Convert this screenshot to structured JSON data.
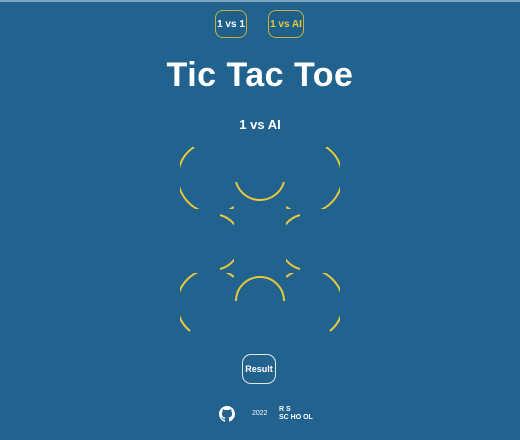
{
  "mode_buttons": {
    "one_vs_one": "1 vs 1",
    "one_vs_ai": "1 vs AI"
  },
  "title": "Tic Tac Toe",
  "current_mode": "1 vs AI",
  "board": {
    "cells": [
      "",
      "",
      "",
      "",
      "",
      "",
      "",
      "",
      ""
    ]
  },
  "result_button": "Result",
  "footer": {
    "year": "2022",
    "logo_text_top": "R S",
    "logo_text_bottom": "SC HO OL"
  },
  "colors": {
    "background": "#21628f",
    "accent_yellow": "#e8c93a",
    "text": "#ffffff"
  }
}
